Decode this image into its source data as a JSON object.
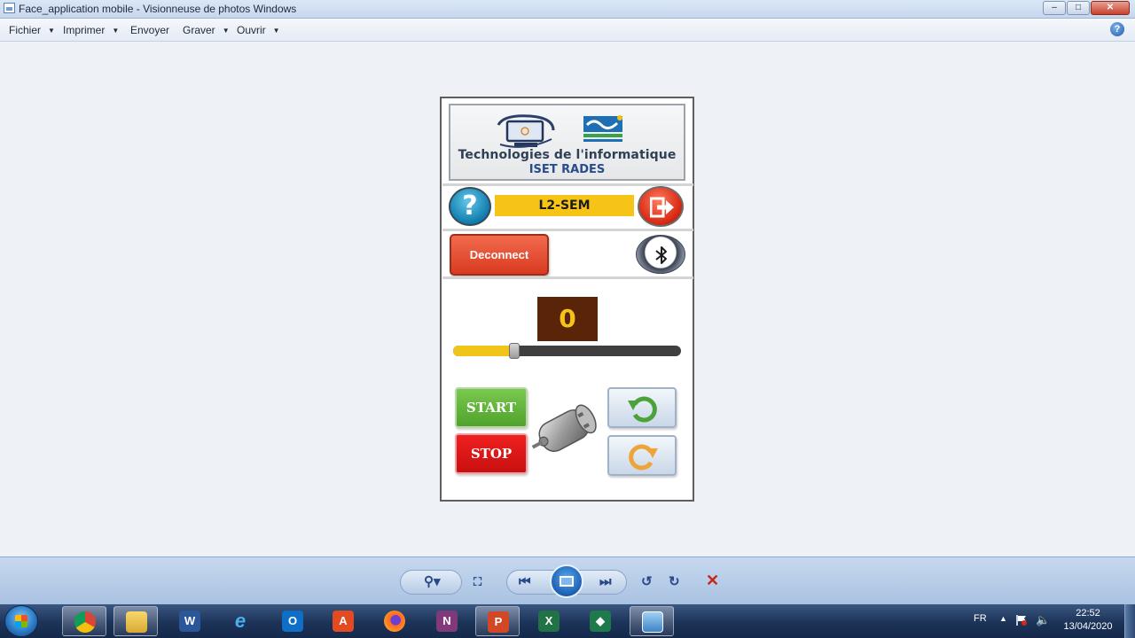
{
  "window": {
    "title": "Face_application mobile - Visionneuse de photos Windows",
    "controls": {
      "minimize": "–",
      "maximize": "□",
      "close": "✕"
    }
  },
  "menu": {
    "items": [
      "Fichier",
      "Imprimer",
      "Envoyer",
      "Graver",
      "Ouvrir"
    ],
    "help": "?"
  },
  "app": {
    "banner": {
      "title": "Technologies de l'informatique",
      "subtitle": "ISET RADES"
    },
    "help_button": "?",
    "class_label": "L2-SEM",
    "disconnect_label": "Deconnect",
    "counter_value": "0",
    "slider_level": 0.27,
    "start_label": "START",
    "stop_label": "STOP",
    "colors": {
      "accent_yellow": "#f5c417",
      "counter_bg": "#5a2408",
      "start_green": "#5aaf35",
      "stop_red": "#e01515",
      "disconnect_red": "#e4472b"
    }
  },
  "taskbar": {
    "apps": [
      "chrome",
      "file-explorer",
      "word",
      "internet-explorer",
      "outlook",
      "acrobat",
      "firefox",
      "onenote",
      "powerpoint",
      "excel",
      "project",
      "photo-viewer"
    ],
    "language": "FR",
    "time": "22:52",
    "date": "13/04/2020"
  }
}
